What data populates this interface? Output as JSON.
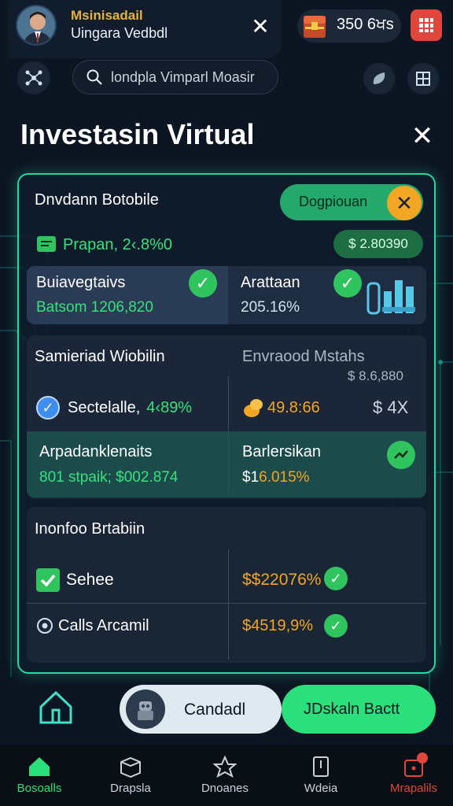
{
  "header": {
    "user_name": "Msinisadail",
    "user_sub": "Uingara Vedbdl",
    "coins": "350 6ਖs",
    "search_text": "londpla Vimparl Moasir"
  },
  "page": {
    "title": "Investasin Virtual"
  },
  "portfolio": {
    "title": "Dnvdann Botobile",
    "pill_label": "Dogpiouan",
    "stat_label": "Prapan, 2‹.8%0",
    "stat_amount": "$ 2.80390",
    "left_label": "Buiavegtaivs",
    "left_value": "Batsom 1206,820",
    "right_label": "Arattaan",
    "right_value": "205.16%"
  },
  "market": {
    "title": "Samieriad Wiobilin",
    "right_title": "Envraood Mstahs",
    "right_amount": "$ 8.6,880",
    "row1_label": "Sectelalle,",
    "row1_pct": "4‹89%",
    "row1_mid": "49.8:66",
    "row1_right": "$ 4X",
    "row2_label": "Arpadanklenaits",
    "row2_value": "801 stpaik; $002.874",
    "row2_right_label": "Barlersikan",
    "row2_right_value": "6.015%",
    "row2_right_prefix": "$1 "
  },
  "info": {
    "title": "Inonfoo Brtabiin",
    "row1_label": "Sehee",
    "row1_value": "$$22076%",
    "row2_label": "Calls Arcamil",
    "row2_value": "$4519,9%"
  },
  "controls": {
    "toggle_left": "Candadl",
    "toggle_right": "JDskaln Bactt"
  },
  "tabs": [
    {
      "label": "Bosoalls"
    },
    {
      "label": "Drapsla"
    },
    {
      "label": "Dnoanes"
    },
    {
      "label": "Wdeia"
    },
    {
      "label": "Mrapalils"
    }
  ],
  "colors": {
    "accent_green": "#2ad6a0",
    "alert_red": "#e0473c",
    "gold": "#f2a623"
  }
}
